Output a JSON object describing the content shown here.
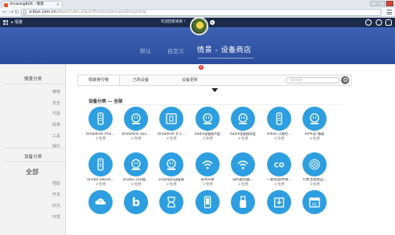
{
  "browser": {
    "tab_title": "AmazingBOX - 情景",
    "url_host": "a-box.com.cn",
    "url_path": "/abox/index.php/c/Process/processShop/shop"
  },
  "app_header": {
    "back_label": "情景",
    "welcome": "欢迎回家果果 !"
  },
  "banner": {
    "nav": [
      "默认",
      "自定义"
    ],
    "title": "情景 - 设备商店"
  },
  "sidebar": {
    "scene_heading": "情景分类",
    "scene_items": [
      "推荐",
      "安全",
      "节能",
      "效率",
      "工具",
      "娱乐"
    ],
    "device_heading": "设备分类",
    "device_active": "全部",
    "device_items": [
      "插座",
      "开关",
      "红外",
      "环境"
    ]
  },
  "tabs": [
    {
      "label": "情景排行榜"
    },
    {
      "label": "已购设备"
    },
    {
      "label": "设备更新"
    }
  ],
  "update_badge": "2",
  "search": {
    "placeholder": "搜索情景"
  },
  "section_title": "设备分类 — 全部",
  "apps": [
    {
      "name": "broadlink rm2...",
      "price": "￥免费",
      "icon": "remote-icon"
    },
    {
      "name": "broadlink sp2...",
      "price": "￥免费",
      "icon": "plug-icon"
    },
    {
      "name": "broadlink tc1...",
      "price": "￥免费",
      "icon": "switch-panel-icon"
    },
    {
      "name": "eading插座A型",
      "price": "￥免费",
      "icon": "plug-icon"
    },
    {
      "name": "eading插座B型",
      "price": "￥免费",
      "icon": "plug-icon"
    },
    {
      "name": "index i3遥控...",
      "price": "￥免费",
      "icon": "remote-icon"
    },
    {
      "name": "mPlug 插座",
      "price": "￥免费",
      "icon": "plug-icon"
    },
    {
      "name": "orvibo allone...",
      "price": "￥免费",
      "icon": "remote-icon"
    },
    {
      "name": "orvibo s20插...",
      "price": "￥免费",
      "icon": "plug-icon"
    },
    {
      "name": "smartplug插座",
      "price": "￥免费",
      "icon": "plug-icon"
    },
    {
      "name": "wifi开关",
      "price": "￥免费",
      "icon": "wifi-icon"
    },
    {
      "name": "wifi遥控器...",
      "price": "￥免费",
      "icon": "wifi-icon"
    },
    {
      "name": "一氧化碳传感...",
      "price": "￥免费",
      "icon": "co-icon"
    },
    {
      "name": "人体活动感应...",
      "price": "￥免费",
      "icon": "motion-sensor-icon"
    },
    {
      "name": "",
      "price": "",
      "icon": "cloud-question-icon"
    },
    {
      "name": "",
      "price": "",
      "icon": "brand-b-icon"
    },
    {
      "name": "",
      "price": "",
      "icon": "hourglass-icon"
    },
    {
      "name": "",
      "price": "",
      "icon": "phone-icon"
    },
    {
      "name": "",
      "price": "",
      "icon": "usb-icon"
    },
    {
      "name": "",
      "price": "",
      "icon": "download-box-icon"
    },
    {
      "name": "",
      "price": "",
      "icon": "calendar-icon"
    }
  ],
  "colors": {
    "header": "#1b2b4a",
    "banner": "#3e61b2",
    "icon_circle": "#2d9fe0",
    "badge": "#e33333"
  }
}
